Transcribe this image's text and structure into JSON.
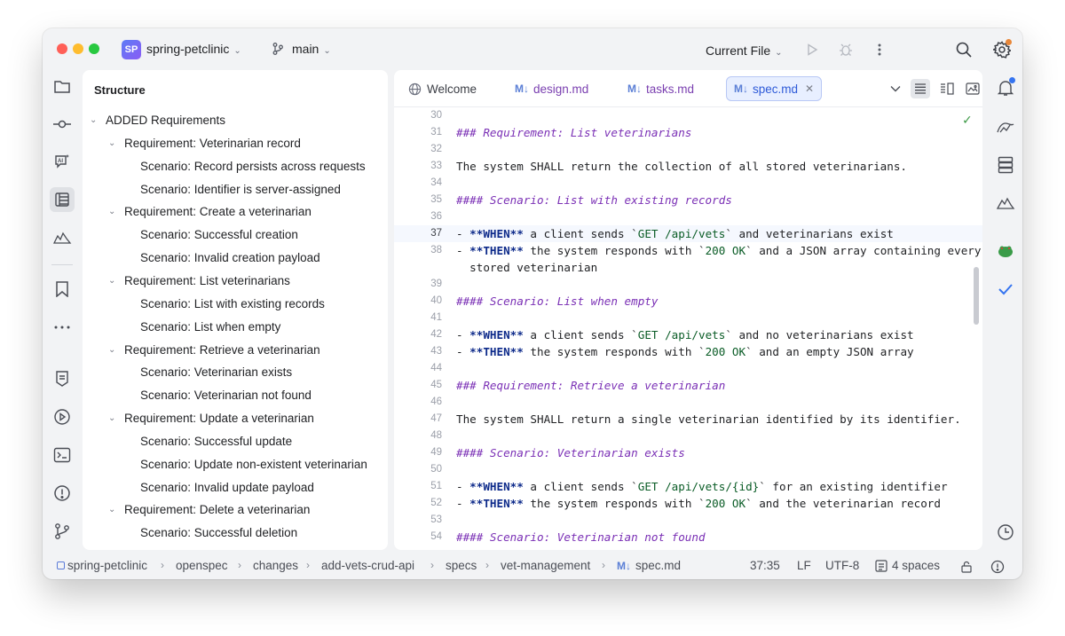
{
  "window": {
    "project_badge": "SP",
    "project_name": "spring-petclinic",
    "branch": "main",
    "run_config": "Current File"
  },
  "structure": {
    "title": "Structure",
    "items": [
      {
        "label": "ADDED Requirements",
        "level": 0,
        "expanded": true
      },
      {
        "label": "Requirement: Veterinarian record",
        "level": 1,
        "expanded": true
      },
      {
        "label": "Scenario: Record persists across requests",
        "level": 2
      },
      {
        "label": "Scenario: Identifier is server-assigned",
        "level": 2
      },
      {
        "label": "Requirement: Create a veterinarian",
        "level": 1,
        "expanded": true
      },
      {
        "label": "Scenario: Successful creation",
        "level": 2
      },
      {
        "label": "Scenario: Invalid creation payload",
        "level": 2
      },
      {
        "label": "Requirement: List veterinarians",
        "level": 1,
        "expanded": true
      },
      {
        "label": "Scenario: List with existing records",
        "level": 2
      },
      {
        "label": "Scenario: List when empty",
        "level": 2
      },
      {
        "label": "Requirement: Retrieve a veterinarian",
        "level": 1,
        "expanded": true
      },
      {
        "label": "Scenario: Veterinarian exists",
        "level": 2
      },
      {
        "label": "Scenario: Veterinarian not found",
        "level": 2
      },
      {
        "label": "Requirement: Update a veterinarian",
        "level": 1,
        "expanded": true
      },
      {
        "label": "Scenario: Successful update",
        "level": 2
      },
      {
        "label": "Scenario: Update non-existent veterinarian",
        "level": 2
      },
      {
        "label": "Scenario: Invalid update payload",
        "level": 2
      },
      {
        "label": "Requirement: Delete a veterinarian",
        "level": 1,
        "expanded": true
      },
      {
        "label": "Scenario: Successful deletion",
        "level": 2
      }
    ]
  },
  "editor": {
    "tabs": [
      {
        "label": "Welcome",
        "icon": "globe-icon",
        "active": false
      },
      {
        "label": "design.md",
        "icon": "markdown-icon",
        "active": false
      },
      {
        "label": "tasks.md",
        "icon": "markdown-icon",
        "active": false
      },
      {
        "label": "spec.md",
        "icon": "markdown-icon",
        "active": true
      }
    ],
    "md_badge": "M↓",
    "current_line": "37",
    "lines": [
      {
        "n": "30",
        "segs": []
      },
      {
        "n": "31",
        "segs": [
          {
            "t": "### Requirement: List veterinarians",
            "c": "h"
          }
        ]
      },
      {
        "n": "32",
        "segs": []
      },
      {
        "n": "33",
        "segs": [
          {
            "t": "The system SHALL return the collection of all stored veterinarians.",
            "c": ""
          }
        ]
      },
      {
        "n": "34",
        "segs": []
      },
      {
        "n": "35",
        "segs": [
          {
            "t": "#### Scenario: List with existing records",
            "c": "h"
          }
        ]
      },
      {
        "n": "36",
        "segs": []
      },
      {
        "n": "37",
        "segs": [
          {
            "t": "- ",
            "c": ""
          },
          {
            "t": "**WHEN**",
            "c": "b"
          },
          {
            "t": " a client sends `",
            "c": ""
          },
          {
            "t": "GET /api/vets",
            "c": "bk"
          },
          {
            "t": "` and veterinarians exist",
            "c": ""
          }
        ]
      },
      {
        "n": "38",
        "segs": [
          {
            "t": "- ",
            "c": ""
          },
          {
            "t": "**THEN**",
            "c": "b"
          },
          {
            "t": " the system responds with `",
            "c": ""
          },
          {
            "t": "200 OK",
            "c": "bk"
          },
          {
            "t": "` and a JSON array containing every",
            "c": ""
          }
        ]
      },
      {
        "n": "",
        "segs": [
          {
            "t": "  stored veterinarian",
            "c": ""
          }
        ]
      },
      {
        "n": "39",
        "segs": []
      },
      {
        "n": "40",
        "segs": [
          {
            "t": "#### Scenario: List when empty",
            "c": "h"
          }
        ]
      },
      {
        "n": "41",
        "segs": []
      },
      {
        "n": "42",
        "segs": [
          {
            "t": "- ",
            "c": ""
          },
          {
            "t": "**WHEN**",
            "c": "b"
          },
          {
            "t": " a client sends `",
            "c": ""
          },
          {
            "t": "GET /api/vets",
            "c": "bk"
          },
          {
            "t": "` and no veterinarians exist",
            "c": ""
          }
        ]
      },
      {
        "n": "43",
        "segs": [
          {
            "t": "- ",
            "c": ""
          },
          {
            "t": "**THEN**",
            "c": "b"
          },
          {
            "t": " the system responds with `",
            "c": ""
          },
          {
            "t": "200 OK",
            "c": "bk"
          },
          {
            "t": "` and an empty JSON array",
            "c": ""
          }
        ]
      },
      {
        "n": "44",
        "segs": []
      },
      {
        "n": "45",
        "segs": [
          {
            "t": "### Requirement: Retrieve a veterinarian",
            "c": "h"
          }
        ]
      },
      {
        "n": "46",
        "segs": []
      },
      {
        "n": "47",
        "segs": [
          {
            "t": "The system SHALL return a single veterinarian identified by its identifier.",
            "c": ""
          }
        ]
      },
      {
        "n": "48",
        "segs": []
      },
      {
        "n": "49",
        "segs": [
          {
            "t": "#### Scenario: Veterinarian exists",
            "c": "h"
          }
        ]
      },
      {
        "n": "50",
        "segs": []
      },
      {
        "n": "51",
        "segs": [
          {
            "t": "- ",
            "c": ""
          },
          {
            "t": "**WHEN**",
            "c": "b"
          },
          {
            "t": " a client sends `",
            "c": ""
          },
          {
            "t": "GET /api/vets/{id}",
            "c": "bk"
          },
          {
            "t": "` for an existing identifier",
            "c": ""
          }
        ]
      },
      {
        "n": "52",
        "segs": [
          {
            "t": "- ",
            "c": ""
          },
          {
            "t": "**THEN**",
            "c": "b"
          },
          {
            "t": " the system responds with `",
            "c": ""
          },
          {
            "t": "200 OK",
            "c": "bk"
          },
          {
            "t": "` and the veterinarian record",
            "c": ""
          }
        ]
      },
      {
        "n": "53",
        "segs": []
      },
      {
        "n": "54",
        "segs": [
          {
            "t": "#### Scenario: Veterinarian not found",
            "c": "h"
          }
        ]
      }
    ]
  },
  "statusbar": {
    "breadcrumbs": [
      "spring-petclinic",
      "openspec",
      "changes",
      "add-vets-crud-api",
      "specs",
      "vet-management",
      "spec.md"
    ],
    "position": "37:35",
    "line_ending": "LF",
    "encoding": "UTF-8",
    "indent": "4 spaces"
  }
}
